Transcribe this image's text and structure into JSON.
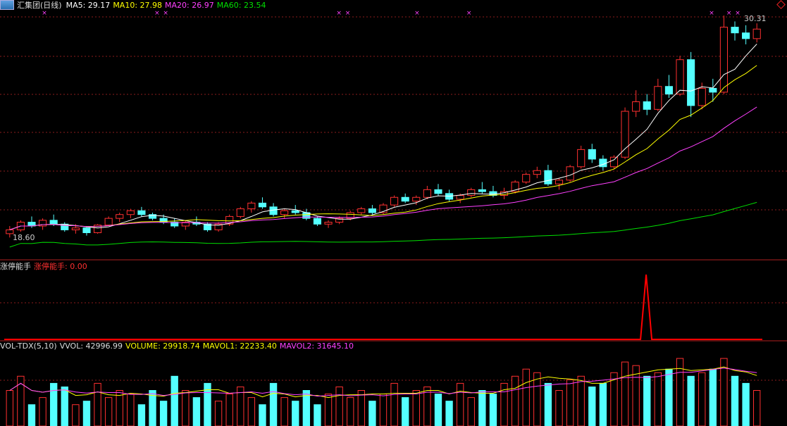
{
  "main_header": {
    "title": "汇集团(日线)",
    "ma5_label": "MA5: 29.17",
    "ma10_label": "MA10: 27.98",
    "ma20_label": "MA20: 26.97",
    "ma60_label": "MA60: 23.54"
  },
  "mid_header": {
    "title": "涨停能手",
    "value_label": "涨停能手: 0.00"
  },
  "vol_header": {
    "title": "VOL-TDX(5,10)",
    "vvol_label": "VVOL: 42996.99",
    "volume_label": "VOLUME: 29918.74",
    "mavol1_label": "MAVOL1: 22233.40",
    "mavol2_label": "MAVOL2: 31645.10"
  },
  "price_markers": {
    "high": "30.31",
    "low": "18.60"
  },
  "colors": {
    "up": "#ff3030",
    "down": "#54ffff",
    "ma5": "#ffffff",
    "ma10": "#ffff00",
    "ma20": "#ff40ff",
    "ma60": "#00e000",
    "grid": "#8c1c1c",
    "signal": "#ff0000"
  },
  "chart_data": {
    "type": "candlestick",
    "price_range": [
      18.6,
      30.31
    ],
    "candles": [
      [
        18.9,
        19.3,
        18.7,
        19.1
      ],
      [
        19.1,
        19.6,
        19.0,
        19.5
      ],
      [
        19.5,
        19.8,
        19.2,
        19.3
      ],
      [
        19.3,
        19.7,
        19.1,
        19.6
      ],
      [
        19.6,
        19.9,
        19.3,
        19.4
      ],
      [
        19.4,
        19.5,
        19.0,
        19.1
      ],
      [
        19.1,
        19.4,
        18.9,
        19.2
      ],
      [
        19.2,
        19.3,
        18.8,
        18.95
      ],
      [
        18.95,
        19.4,
        18.9,
        19.35
      ],
      [
        19.35,
        19.8,
        19.3,
        19.7
      ],
      [
        19.7,
        20.0,
        19.5,
        19.9
      ],
      [
        19.9,
        20.2,
        19.7,
        20.1
      ],
      [
        20.1,
        20.3,
        19.8,
        19.9
      ],
      [
        19.9,
        20.0,
        19.6,
        19.7
      ],
      [
        19.7,
        19.9,
        19.4,
        19.5
      ],
      [
        19.5,
        19.7,
        19.2,
        19.3
      ],
      [
        19.3,
        19.6,
        19.1,
        19.5
      ],
      [
        19.5,
        19.8,
        19.3,
        19.4
      ],
      [
        19.4,
        19.5,
        19.0,
        19.1
      ],
      [
        19.1,
        19.5,
        19.0,
        19.4
      ],
      [
        19.4,
        19.9,
        19.3,
        19.8
      ],
      [
        19.8,
        20.3,
        19.7,
        20.2
      ],
      [
        20.2,
        20.6,
        20.0,
        20.5
      ],
      [
        20.5,
        20.8,
        20.2,
        20.3
      ],
      [
        20.3,
        20.5,
        19.8,
        19.9
      ],
      [
        19.9,
        20.2,
        19.7,
        20.1
      ],
      [
        20.1,
        20.4,
        19.9,
        20.0
      ],
      [
        20.0,
        20.2,
        19.6,
        19.7
      ],
      [
        19.7,
        19.8,
        19.3,
        19.4
      ],
      [
        19.4,
        19.6,
        19.2,
        19.5
      ],
      [
        19.5,
        19.8,
        19.4,
        19.7
      ],
      [
        19.7,
        20.1,
        19.6,
        20.0
      ],
      [
        20.0,
        20.3,
        19.9,
        20.2
      ],
      [
        20.2,
        20.4,
        19.9,
        20.0
      ],
      [
        20.0,
        20.5,
        19.9,
        20.4
      ],
      [
        20.4,
        20.9,
        20.3,
        20.8
      ],
      [
        20.8,
        21.0,
        20.5,
        20.6
      ],
      [
        20.6,
        20.9,
        20.4,
        20.8
      ],
      [
        20.8,
        21.4,
        20.7,
        21.2
      ],
      [
        21.2,
        21.5,
        20.9,
        21.0
      ],
      [
        21.0,
        21.2,
        20.6,
        20.7
      ],
      [
        20.7,
        21.0,
        20.5,
        20.9
      ],
      [
        20.9,
        21.3,
        20.8,
        21.2
      ],
      [
        21.2,
        21.6,
        21.0,
        21.1
      ],
      [
        21.1,
        21.4,
        20.8,
        20.9
      ],
      [
        20.9,
        21.3,
        20.7,
        21.1
      ],
      [
        21.1,
        21.7,
        21.0,
        21.6
      ],
      [
        21.6,
        22.1,
        21.5,
        22.0
      ],
      [
        22.0,
        22.4,
        21.8,
        22.2
      ],
      [
        22.2,
        22.5,
        21.4,
        21.5
      ],
      [
        21.5,
        21.8,
        21.2,
        21.7
      ],
      [
        21.7,
        22.5,
        21.6,
        22.4
      ],
      [
        22.4,
        23.5,
        22.3,
        23.3
      ],
      [
        23.3,
        23.6,
        22.6,
        22.8
      ],
      [
        22.8,
        23.0,
        22.2,
        22.4
      ],
      [
        22.4,
        23.0,
        22.3,
        22.9
      ],
      [
        22.9,
        25.5,
        22.8,
        25.3
      ],
      [
        25.3,
        26.4,
        25.0,
        25.8
      ],
      [
        25.8,
        26.2,
        25.1,
        25.4
      ],
      [
        25.4,
        27.0,
        25.3,
        26.6
      ],
      [
        26.6,
        27.2,
        26.0,
        26.2
      ],
      [
        26.2,
        28.2,
        26.1,
        28.0
      ],
      [
        28.0,
        28.4,
        25.0,
        25.6
      ],
      [
        25.6,
        26.8,
        25.4,
        26.5
      ],
      [
        26.5,
        27.0,
        25.8,
        26.3
      ],
      [
        26.3,
        30.31,
        26.2,
        29.7
      ],
      [
        29.7,
        30.0,
        29.0,
        29.4
      ],
      [
        29.4,
        29.8,
        28.8,
        29.1
      ],
      [
        29.1,
        29.9,
        28.9,
        29.6
      ]
    ],
    "volume_levels": [
      0.5,
      0.7,
      0.3,
      0.4,
      0.6,
      0.55,
      0.3,
      0.35,
      0.6,
      0.4,
      0.5,
      0.45,
      0.3,
      0.5,
      0.35,
      0.7,
      0.5,
      0.4,
      0.6,
      0.35,
      0.45,
      0.55,
      0.4,
      0.3,
      0.6,
      0.4,
      0.35,
      0.5,
      0.3,
      0.45,
      0.55,
      0.4,
      0.5,
      0.35,
      0.45,
      0.6,
      0.4,
      0.5,
      0.55,
      0.45,
      0.35,
      0.6,
      0.4,
      0.5,
      0.45,
      0.6,
      0.7,
      0.8,
      0.75,
      0.6,
      0.5,
      0.65,
      0.7,
      0.55,
      0.6,
      0.75,
      0.9,
      0.85,
      0.7,
      0.75,
      0.8,
      0.95,
      0.7,
      0.75,
      0.8,
      0.95,
      0.7,
      0.6,
      0.5
    ],
    "signal_peak_index": 56
  }
}
